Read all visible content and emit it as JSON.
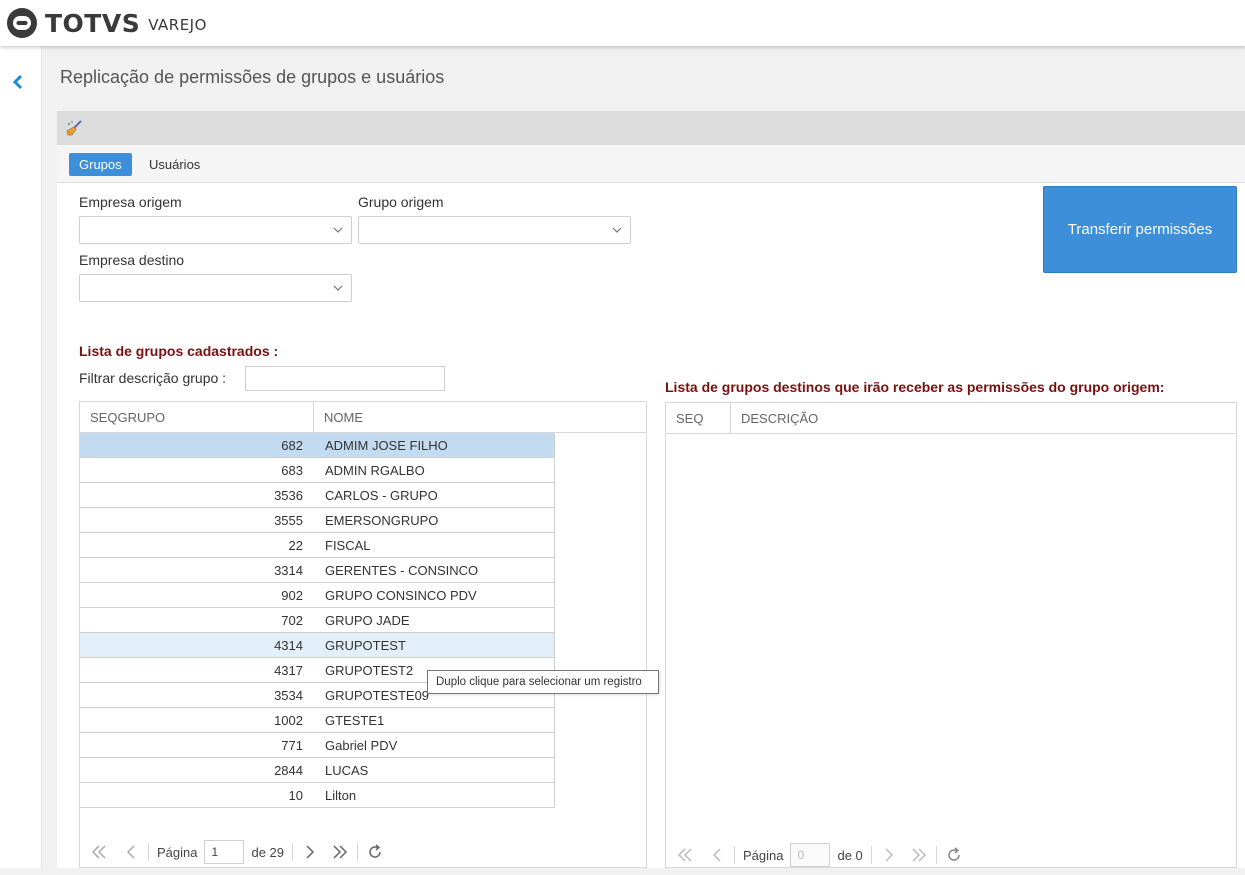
{
  "app": {
    "brand": "TOTVS",
    "brand_sub": "VAREJO"
  },
  "page_title": "Replicação de permissões de grupos e usuários",
  "toolbar": {
    "clear_icon": "broom-icon"
  },
  "tabs": [
    {
      "label": "Grupos",
      "active": true
    },
    {
      "label": "Usuários",
      "active": false
    }
  ],
  "form": {
    "empresa_origem_label": "Empresa origem",
    "grupo_origem_label": "Grupo origem",
    "empresa_destino_label": "Empresa destino",
    "empresa_origem_value": "",
    "grupo_origem_value": "",
    "empresa_destino_value": "",
    "transfer_button": "Transferir permissões"
  },
  "left_list": {
    "title": "Lista de grupos cadastrados :",
    "filter_label": "Filtrar descrição grupo :",
    "filter_value": "",
    "columns": [
      "SEQGRUPO",
      "NOME"
    ],
    "rows": [
      {
        "seq": "682",
        "nome": "ADMIM JOSE FILHO",
        "state": "selected"
      },
      {
        "seq": "683",
        "nome": "ADMIN RGALBO"
      },
      {
        "seq": "3536",
        "nome": "CARLOS - GRUPO"
      },
      {
        "seq": "3555",
        "nome": "EMERSONGRUPO"
      },
      {
        "seq": "22",
        "nome": "FISCAL"
      },
      {
        "seq": "3314",
        "nome": "GERENTES - CONSINCO"
      },
      {
        "seq": "902",
        "nome": "GRUPO CONSINCO PDV"
      },
      {
        "seq": "702",
        "nome": "GRUPO JADE"
      },
      {
        "seq": "4314",
        "nome": "GRUPOTEST",
        "state": "hover"
      },
      {
        "seq": "4317",
        "nome": "GRUPOTEST2"
      },
      {
        "seq": "3534",
        "nome": "GRUPOTESTE09"
      },
      {
        "seq": "1002",
        "nome": "GTESTE1"
      },
      {
        "seq": "771",
        "nome": "Gabriel PDV"
      },
      {
        "seq": "2844",
        "nome": "LUCAS"
      },
      {
        "seq": "10",
        "nome": "Lilton"
      }
    ],
    "pager": {
      "page_label": "Página",
      "page": "1",
      "of_label": "de 29"
    }
  },
  "right_list": {
    "title": "Lista de grupos destinos que irão receber as permissões do grupo origem:",
    "columns": [
      "SEQ",
      "DESCRIÇÃO"
    ],
    "pager": {
      "page_label": "Página",
      "page": "0",
      "of_label": "de 0"
    }
  },
  "tooltip": "Duplo clique para selecionar um registro",
  "colors": {
    "accent": "#3c8fd8",
    "section_title": "#7a1010",
    "selected_row": "#c2dbf1"
  }
}
